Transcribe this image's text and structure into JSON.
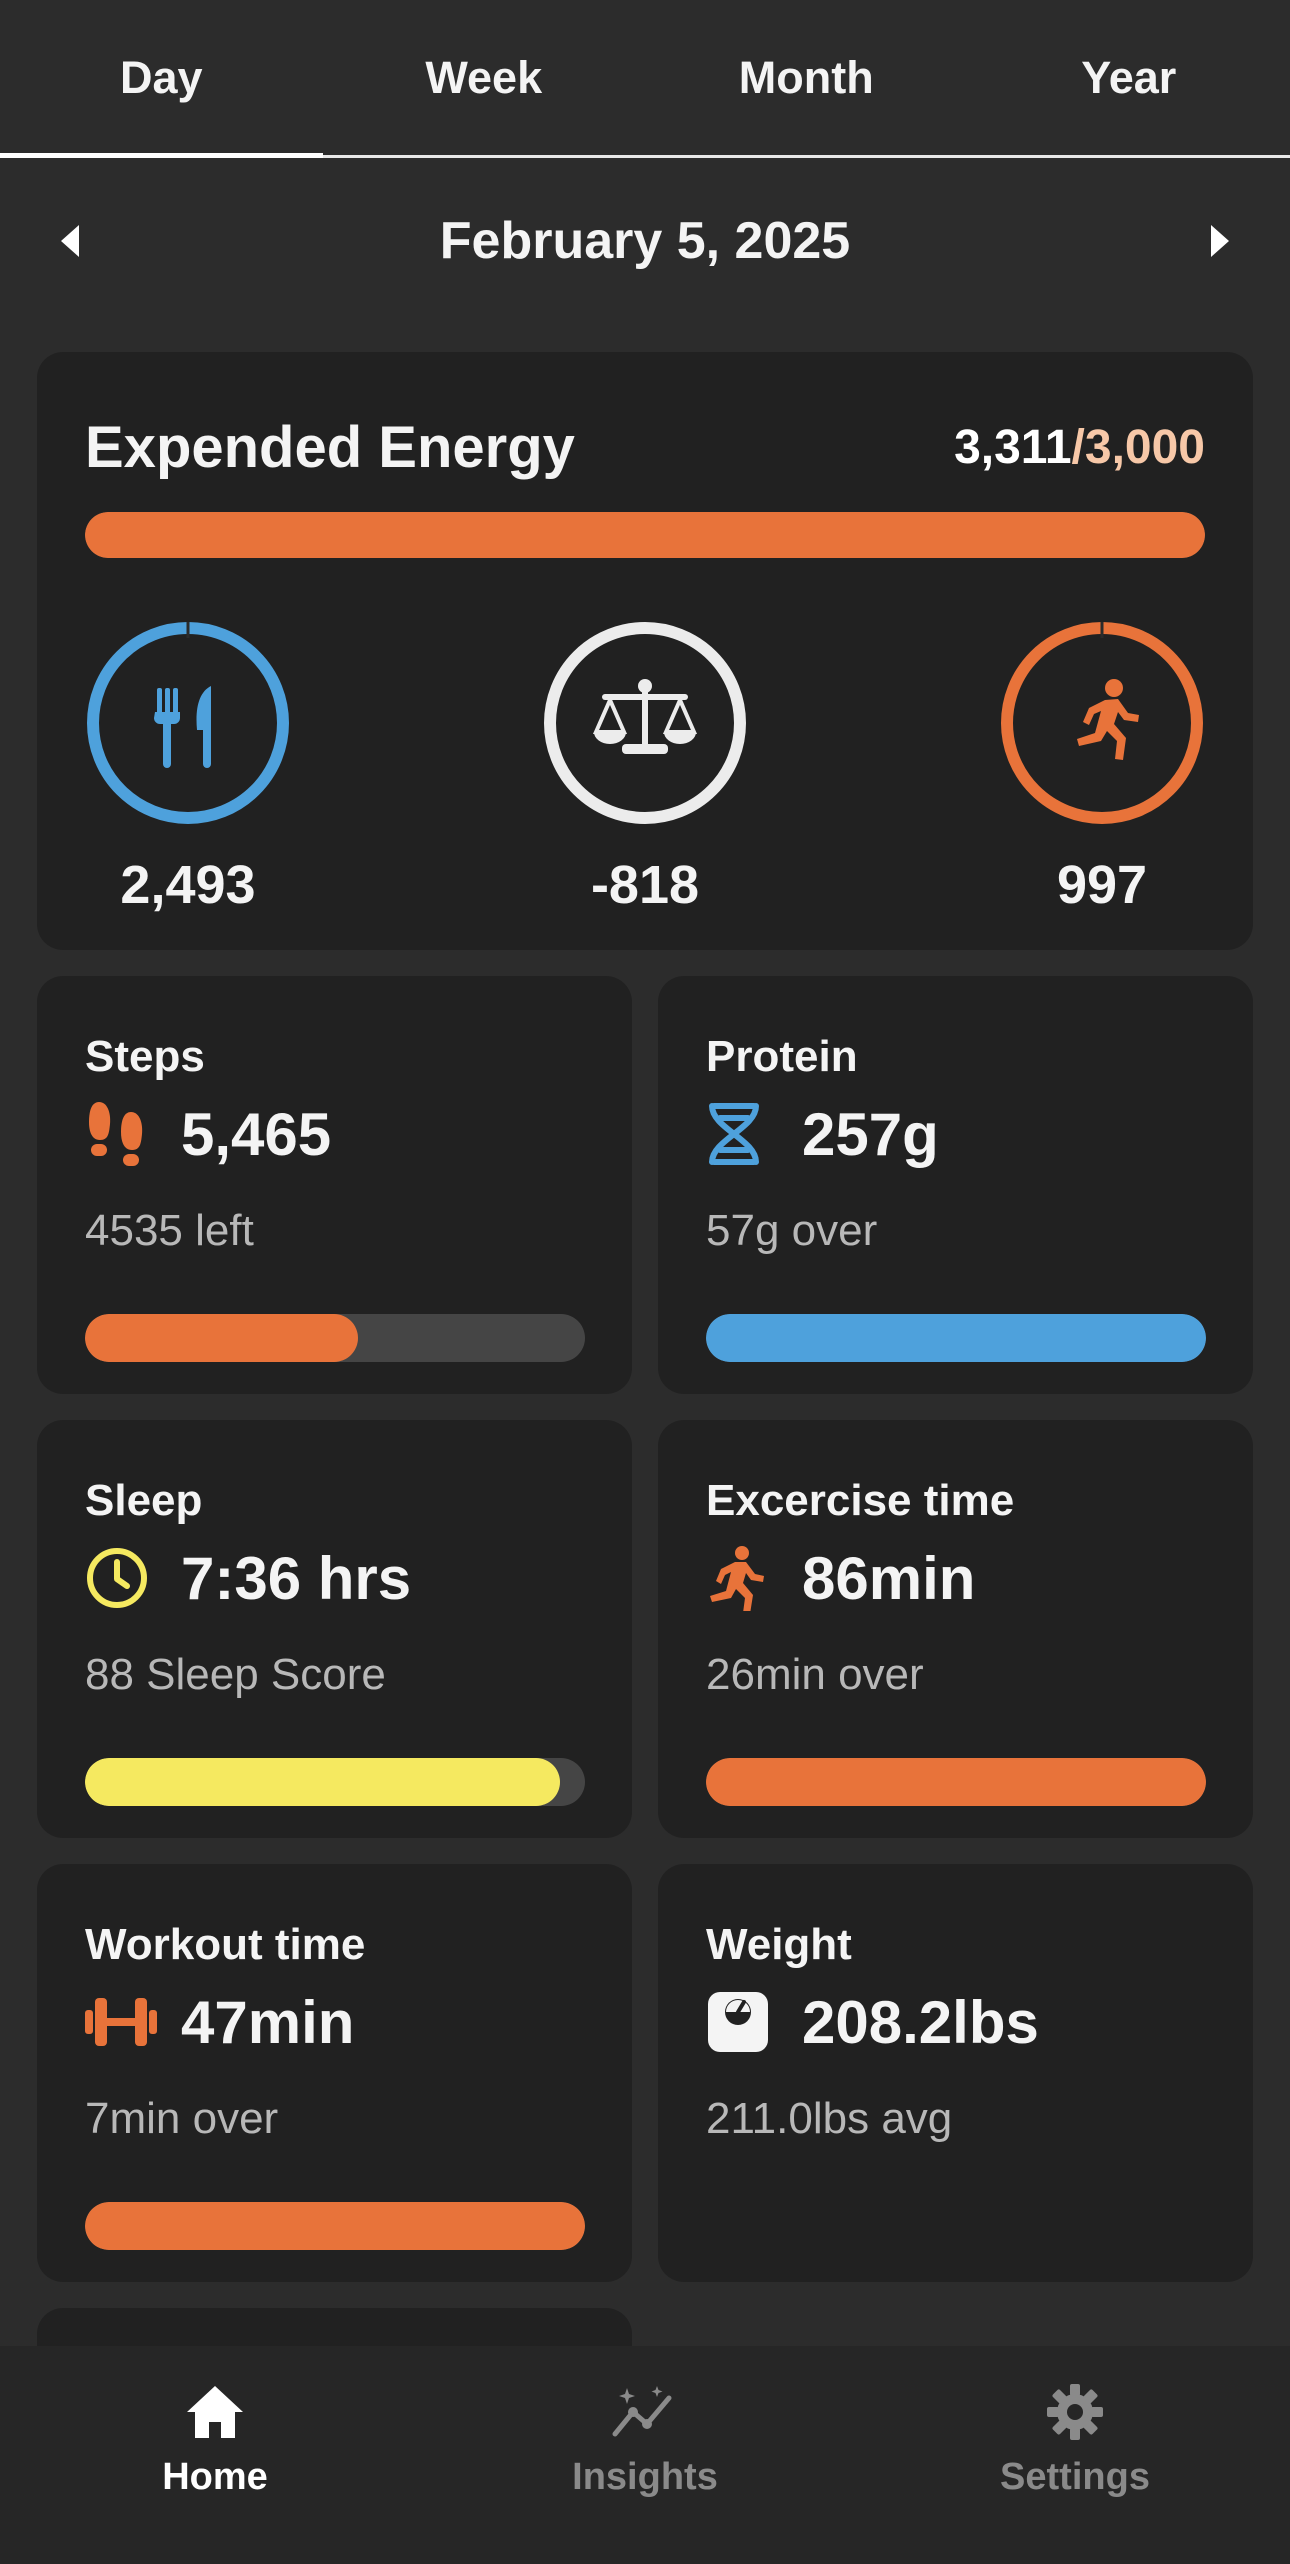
{
  "tabs": [
    {
      "label": "Day",
      "active": true
    },
    {
      "label": "Week",
      "active": false
    },
    {
      "label": "Month",
      "active": false
    },
    {
      "label": "Year",
      "active": false
    }
  ],
  "date_nav": {
    "title": "February 5, 2025",
    "prev_icon": "caret-left-icon",
    "next_icon": "caret-right-icon"
  },
  "energy": {
    "label": "Expended Energy",
    "current": "3,311",
    "goal": "/3,000",
    "progress": 1.0,
    "bar_color": "#e8733a",
    "intake": {
      "icon": "fork-knife-icon",
      "value": "2,493",
      "color": "#4ea1dc"
    },
    "balance": {
      "icon": "scale-icon",
      "value": "-818",
      "color": "#ececec"
    },
    "active": {
      "icon": "running-person-icon",
      "value": "997",
      "color": "#e8733a"
    }
  },
  "stats": {
    "steps": {
      "title": "Steps",
      "value": "5,465",
      "sub": "4535 left",
      "progress": 0.546,
      "color": "#e8733a",
      "icon": "footprints-icon"
    },
    "protein": {
      "title": "Protein",
      "value": "257g",
      "sub": "57g over",
      "progress": 1.0,
      "color": "#4ea1dc",
      "icon": "dna-icon"
    },
    "sleep": {
      "title": "Sleep",
      "value": "7:36 hrs",
      "sub": "88 Sleep Score",
      "progress": 0.95,
      "color": "#f5e960",
      "icon": "clock-icon"
    },
    "exercise": {
      "title": "Excercise time",
      "value": "86min",
      "sub": "26min over",
      "progress": 1.0,
      "color": "#e8733a",
      "icon": "running-person-icon"
    },
    "workout": {
      "title": "Workout time",
      "value": "47min",
      "sub": "7min over",
      "progress": 1.0,
      "color": "#e8733a",
      "icon": "dumbbell-icon"
    },
    "weight": {
      "title": "Weight",
      "value": "208.2lbs",
      "sub": "211.0lbs avg",
      "color": "#f4f4f4",
      "icon": "bathroom-scale-icon"
    }
  },
  "bottom_nav": [
    {
      "label": "Home",
      "icon": "home-icon",
      "active": true
    },
    {
      "label": "Insights",
      "icon": "insights-chart-icon",
      "active": false
    },
    {
      "label": "Settings",
      "icon": "gear-icon",
      "active": false
    }
  ]
}
